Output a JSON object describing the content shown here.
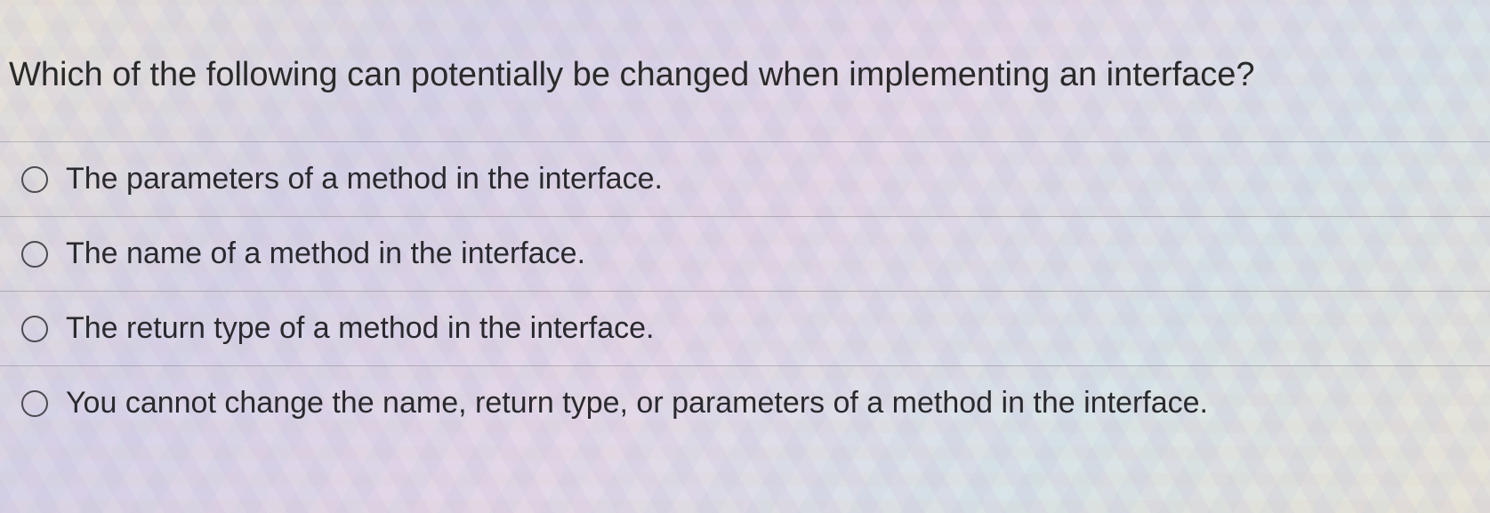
{
  "question": {
    "text": "Which of the following can potentially be changed when implementing an interface?",
    "options": [
      {
        "label": "The parameters of a method in the interface."
      },
      {
        "label": "The name of a method in the interface."
      },
      {
        "label": "The return type of a method in the interface."
      },
      {
        "label": "You cannot change the name, return type, or parameters of a method in the interface."
      }
    ]
  }
}
